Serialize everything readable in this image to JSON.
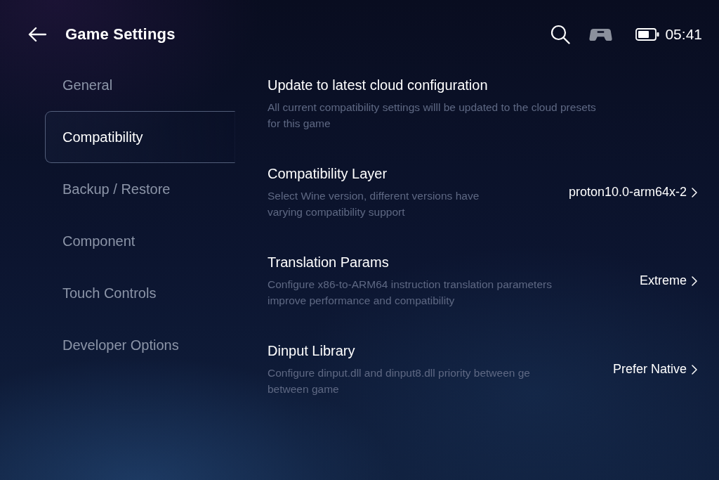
{
  "header": {
    "title": "Game Settings",
    "time": "05:41"
  },
  "sidebar": {
    "items": [
      {
        "label": "General",
        "selected": false
      },
      {
        "label": "Compatibility",
        "selected": true
      },
      {
        "label": "Backup / Restore",
        "selected": false
      },
      {
        "label": "Component",
        "selected": false
      },
      {
        "label": "Touch Controls",
        "selected": false
      },
      {
        "label": "Developer Options",
        "selected": false
      }
    ]
  },
  "settings": [
    {
      "title": "Update to latest cloud configuration",
      "description_lines": [
        "All current compatibility settings willl be updated to the cloud presets",
        "for this game"
      ]
    },
    {
      "title": "Compatibility Layer",
      "description_lines": [
        "Select Wine version, different versions have",
        "varying compatibility support"
      ],
      "value": "proton10.0-arm64x-2"
    },
    {
      "title": "Translation Params",
      "description_lines": [
        "Configure x86-to-ARM64 instruction translation parameters",
        "improve performance and compatibility"
      ],
      "value": "Extreme"
    },
    {
      "title": "Dinput Library",
      "description_lines": [
        "Configure dinput.dll and dinput8.dll priority between ge",
        "between game"
      ],
      "value": "Prefer Native"
    }
  ]
}
